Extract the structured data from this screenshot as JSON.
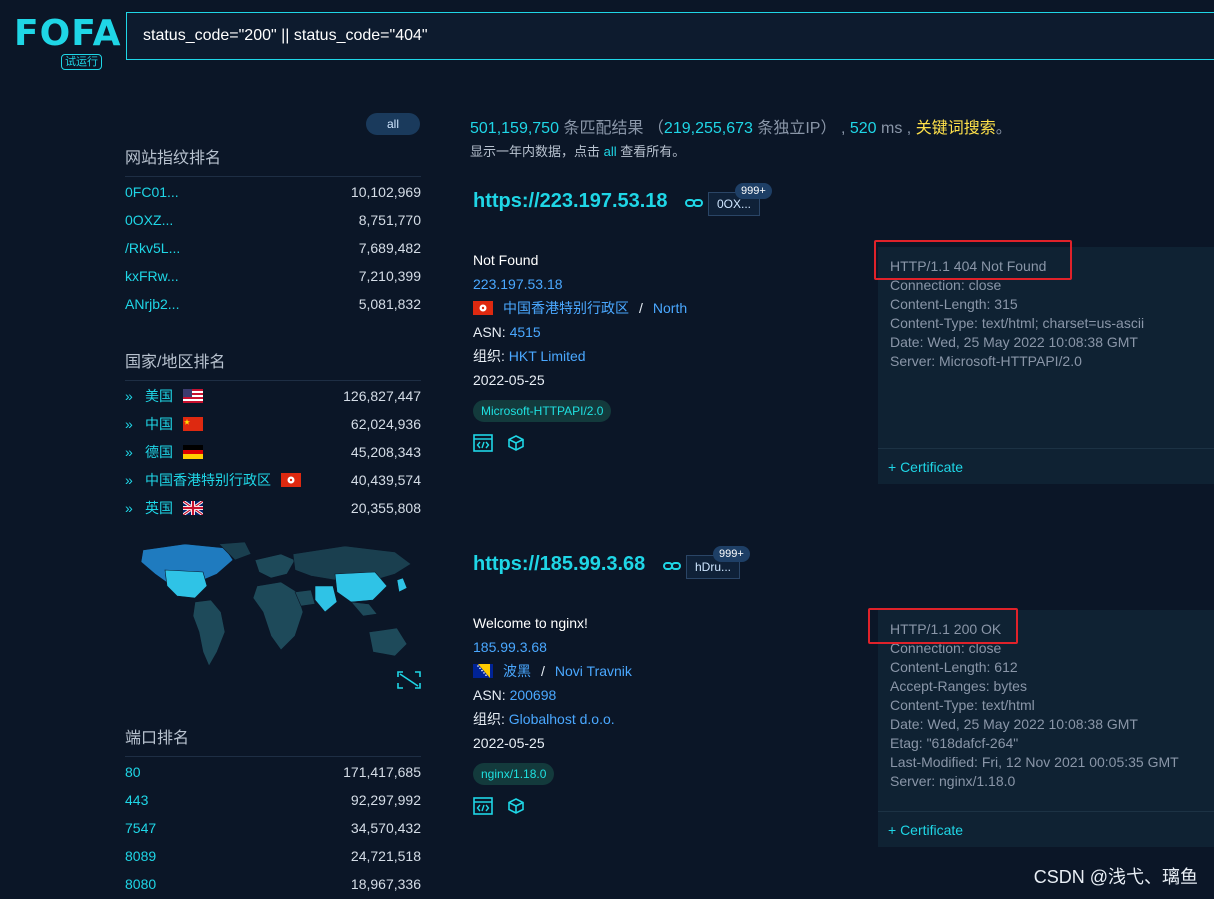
{
  "logo": {
    "text": "FOFA",
    "badge": "试运行"
  },
  "search": {
    "query": "status_code=\"200\" || status_code=\"404\""
  },
  "sidebar": {
    "all_label": "all",
    "fingerprint_title": "网站指纹排名",
    "fingerprints": [
      {
        "name": "0FC01...",
        "count": "10,102,969"
      },
      {
        "name": "0OXZ...",
        "count": "8,751,770"
      },
      {
        "name": "/Rkv5L...",
        "count": "7,689,482"
      },
      {
        "name": "kxFRw...",
        "count": "7,210,399"
      },
      {
        "name": "ANrjb2...",
        "count": "5,081,832"
      }
    ],
    "country_title": "国家/地区排名",
    "countries": [
      {
        "name": "美国",
        "count": "126,827,447",
        "flag": "us"
      },
      {
        "name": "中国",
        "count": "62,024,936",
        "flag": "cn"
      },
      {
        "name": "德国",
        "count": "45,208,343",
        "flag": "de"
      },
      {
        "name": "中国香港特别行政区",
        "count": "40,439,574",
        "flag": "hk"
      },
      {
        "name": "英国",
        "count": "20,355,808",
        "flag": "gb"
      }
    ],
    "port_title": "端口排名",
    "ports": [
      {
        "port": "80",
        "count": "171,417,685"
      },
      {
        "port": "443",
        "count": "92,297,992"
      },
      {
        "port": "7547",
        "count": "34,570,432"
      },
      {
        "port": "8089",
        "count": "24,721,518"
      },
      {
        "port": "8080",
        "count": "18,967,336"
      }
    ]
  },
  "stats": {
    "total": "501,159,750",
    "total_label": "条匹配结果",
    "ip_open": "（",
    "unique_ip": "219,255,673",
    "unique_label": "条独立IP）",
    "comma": ",",
    "ms": "520",
    "ms_label": "ms",
    "keyword": "关键词搜索",
    "period": "。",
    "sub_prefix": "显示一年内数据，点击",
    "sub_all": "all",
    "sub_suffix": "查看所有。"
  },
  "results": [
    {
      "url": "https://223.197.53.18",
      "tag": "0OX...",
      "tag_count": "999+",
      "title": "Not Found",
      "ip": "223.197.53.18",
      "region": "中国香港特别行政区",
      "sep": "/",
      "city": "North",
      "asn_label": "ASN:",
      "asn": "4515",
      "org_label": "组织:",
      "org": "HKT Limited",
      "date": "2022-05-25",
      "server": "Microsoft-HTTPAPI/2.0",
      "headers": "HTTP/1.1 404 Not Found\nConnection: close\nContent-Length: 315\nContent-Type: text/html; charset=us-ascii\nDate: Wed, 25 May 2022 10:08:38 GMT\nServer: Microsoft-HTTPAPI/2.0",
      "cert_label": "+ Certificate"
    },
    {
      "url": "https://185.99.3.68",
      "tag": "hDru...",
      "tag_count": "999+",
      "title": "Welcome to nginx!",
      "ip": "185.99.3.68",
      "region": "波黑",
      "sep": "/",
      "city": "Novi Travnik",
      "asn_label": "ASN:",
      "asn": "200698",
      "org_label": "组织:",
      "org": "Globalhost d.o.o.",
      "date": "2022-05-25",
      "server": "nginx/1.18.0",
      "headers": "HTTP/1.1 200 OK\nConnection: close\nContent-Length: 612\nAccept-Ranges: bytes\nContent-Type: text/html\nDate: Wed, 25 May 2022 10:08:38 GMT\nEtag: \"618dafcf-264\"\nLast-Modified: Fri, 12 Nov 2021 00:05:35 GMT\nServer: nginx/1.18.0",
      "cert_label": "+ Certificate"
    }
  ],
  "watermark": "CSDN @浅弋、璃鱼",
  "colors": {
    "accent": "#1fd6e6",
    "link": "#4aa8ff",
    "highlight": "#e0222a",
    "keyword": "#ffe14a"
  }
}
